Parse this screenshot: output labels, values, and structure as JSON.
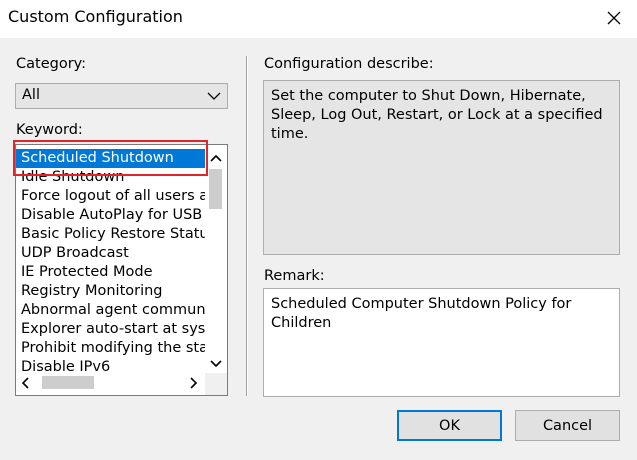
{
  "window": {
    "title": "Custom Configuration"
  },
  "category": {
    "label": "Category:",
    "selected": "All"
  },
  "keyword": {
    "label": "Keyword:",
    "items": [
      "Scheduled Shutdown",
      "Idle Shutdown",
      "Force logout of all users a",
      "Disable AutoPlay for USB d",
      "Basic Policy Restore Statu",
      "UDP Broadcast",
      "IE Protected Mode",
      "Registry Monitoring",
      "Abnormal agent communic",
      "Explorer auto-start at sys",
      "Prohibit modifying the star",
      "Disable IPv6"
    ],
    "selected_index": 0
  },
  "describe": {
    "label": "Configuration describe:",
    "text": "Set the computer to Shut Down, Hibernate, Sleep, Log Out, Restart, or Lock at a specified time."
  },
  "remark": {
    "label": "Remark:",
    "text": "Scheduled Computer Shutdown Policy for Children"
  },
  "buttons": {
    "ok": "OK",
    "cancel": "Cancel"
  },
  "colors": {
    "selection": "#0078d7",
    "highlight_box": "#e0262a",
    "default_button_border": "#0078d7"
  }
}
